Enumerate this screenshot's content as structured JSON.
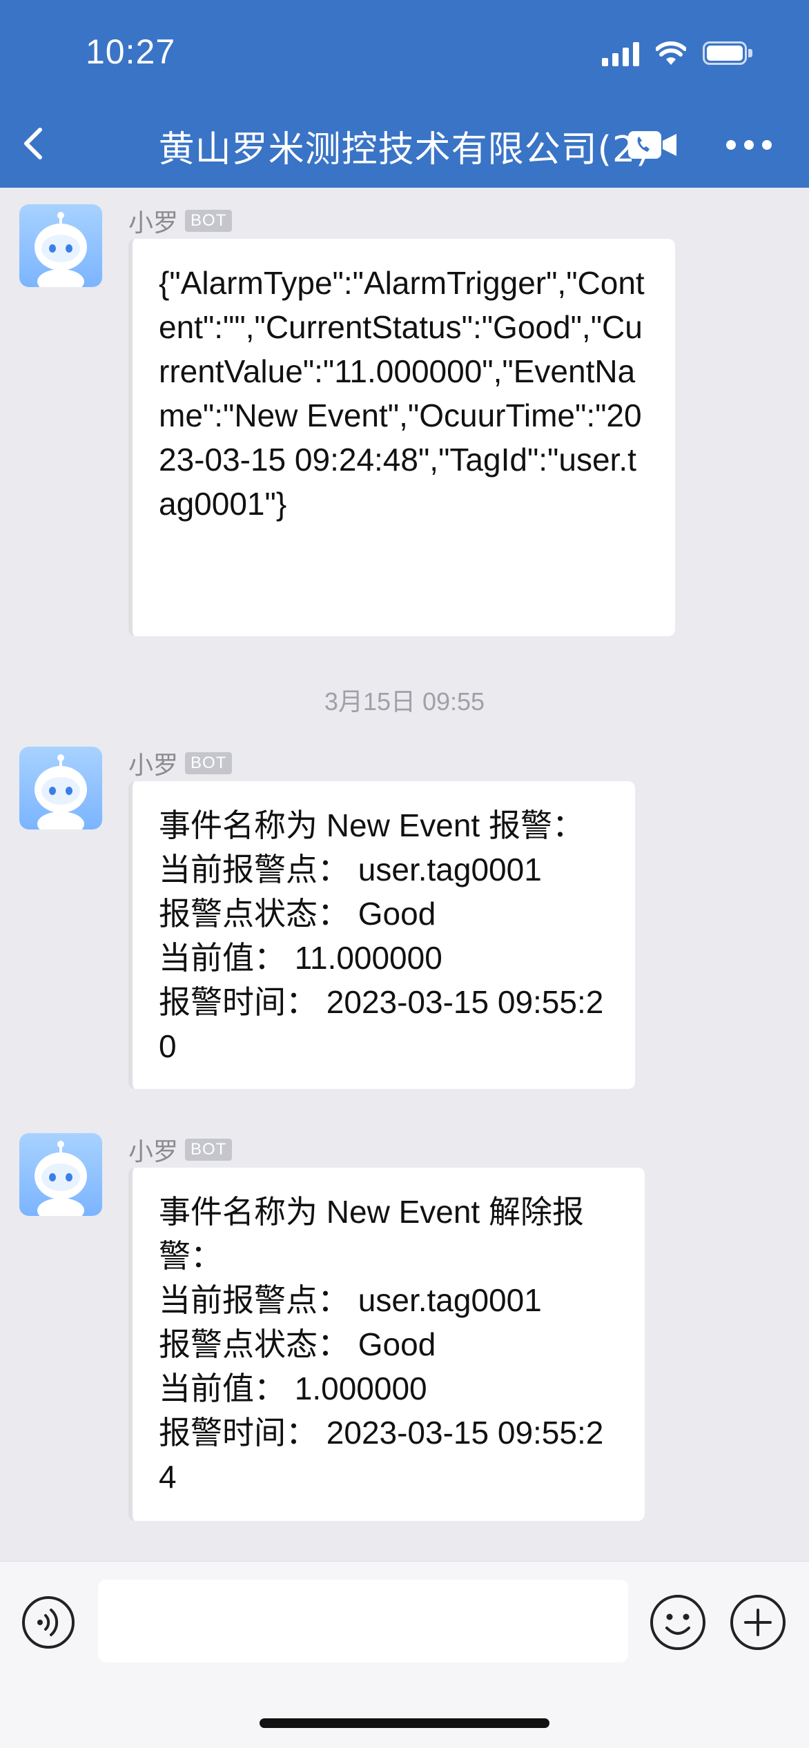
{
  "status_bar": {
    "time": "10:27"
  },
  "header": {
    "title": "黄山罗米测控技术有限公司(2)"
  },
  "timestamp": "3月15日 09:55",
  "messages": [
    {
      "sender": "小罗",
      "badge": "BOT",
      "text": "{\"AlarmType\":\"AlarmTrigger\",\"Content\":\"\",\"CurrentStatus\":\"Good\",\"CurrentValue\":\"11.000000\",\"EventName\":\"New Event\",\"OcuurTime\":\"2023-03-15 09:24:48\",\"TagId\":\"user.tag0001\"}"
    },
    {
      "sender": "小罗",
      "badge": "BOT",
      "text": "事件名称为 New Event 报警：\n当前报警点： user.tag0001\n报警点状态： Good\n当前值： 11.000000\n报警时间： 2023-03-15 09:55:20"
    },
    {
      "sender": "小罗",
      "badge": "BOT",
      "text": "事件名称为 New Event 解除报警：\n当前报警点： user.tag0001\n报警点状态： Good\n当前值： 1.000000\n报警时间： 2023-03-15 09:55:24"
    }
  ],
  "input": {
    "value": "",
    "placeholder": ""
  },
  "colors": {
    "header_bg": "#3a74c6",
    "chat_bg": "#eaeaef",
    "bubble_bg": "#ffffff"
  },
  "icons": [
    "back-icon",
    "video-call-icon",
    "more-icon",
    "voice-icon",
    "emoji-icon",
    "plus-icon",
    "robot-avatar-icon"
  ]
}
